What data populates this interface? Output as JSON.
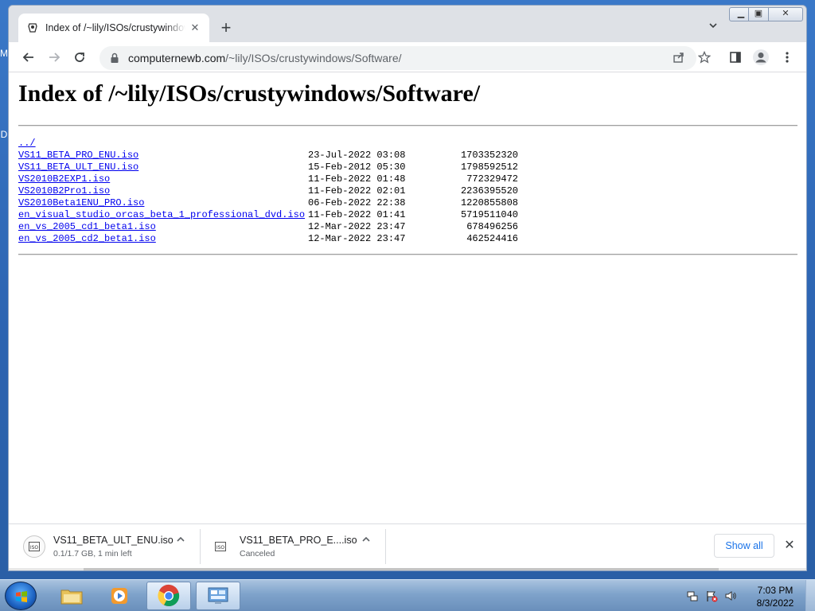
{
  "desktop": {
    "edge_glyphs": [
      "M",
      "D"
    ]
  },
  "browser": {
    "tab": {
      "title": "Index of /~lily/ISOs/crustywindows/Software/",
      "favicon": "apache-index-icon"
    },
    "omnibox": {
      "host": "computernewb.com",
      "path": "/~lily/ISOs/crustywindows/Software/"
    },
    "toolbar_icons": [
      "back-icon",
      "forward-icon",
      "reload-icon",
      "lock-icon",
      "share-icon",
      "star-icon",
      "side-panel-icon",
      "profile-icon",
      "menu-icon"
    ]
  },
  "page": {
    "heading": "Index of /~lily/ISOs/crustywindows/Software/",
    "parent_link": "../",
    "entries": [
      {
        "name": "VS11_BETA_PRO_ENU.iso",
        "date": "23-Jul-2022 03:08",
        "size": "1703352320"
      },
      {
        "name": "VS11_BETA_ULT_ENU.iso",
        "date": "15-Feb-2012 05:30",
        "size": "1798592512"
      },
      {
        "name": "VS2010B2EXP1.iso",
        "date": "11-Feb-2022 01:48",
        "size": "772329472"
      },
      {
        "name": "VS2010B2Pro1.iso",
        "date": "11-Feb-2022 02:01",
        "size": "2236395520"
      },
      {
        "name": "VS2010Beta1ENU_PRO.iso",
        "date": "06-Feb-2022 22:38",
        "size": "1220855808"
      },
      {
        "name": "en_visual_studio_orcas_beta_1_professional_dvd.iso",
        "date": "11-Feb-2022 01:41",
        "size": "5719511040"
      },
      {
        "name": "en_vs_2005_cd1_beta1.iso",
        "date": "12-Mar-2022 23:47",
        "size": "678496256"
      },
      {
        "name": "en_vs_2005_cd2_beta1.iso",
        "date": "12-Mar-2022 23:47",
        "size": "462524416"
      }
    ]
  },
  "downloads": {
    "items": [
      {
        "name": "VS11_BETA_ULT_ENU.iso",
        "status": "0.1/1.7 GB, 1 min left"
      },
      {
        "name": "VS11_BETA_PRO_E....iso",
        "status": "Canceled"
      }
    ],
    "show_all_label": "Show all"
  },
  "taskbar": {
    "clock_time": "7:03 PM",
    "clock_date": "8/3/2022",
    "buttons": [
      "explorer",
      "media-player",
      "chrome",
      "control-panel"
    ]
  },
  "colors": {
    "link": "#0000ee",
    "accent": "#1a73e8",
    "taskbar": "#7fa3cb"
  }
}
